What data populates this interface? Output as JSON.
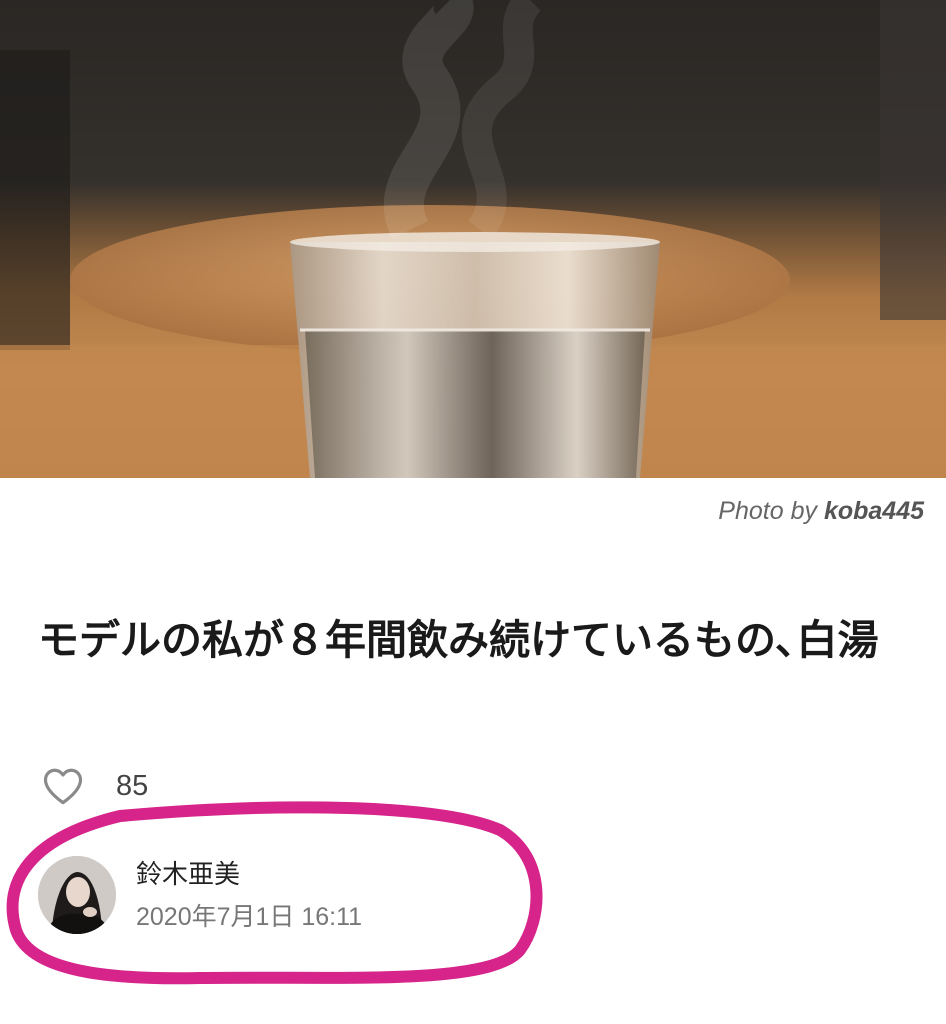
{
  "hero_image": {
    "caption_prefix": "Photo by",
    "caption_author": "koba445"
  },
  "article": {
    "title": "モデルの私が８年間飲み続けているもの､白湯",
    "like_count": "85"
  },
  "author": {
    "name": "鈴木亜美",
    "date": "2020年7月1日 16:11"
  },
  "colors": {
    "highlight": "#d6248a",
    "text": "#1a1a1a",
    "muted": "#777777"
  },
  "icons": {
    "like": "heart-outline-icon"
  }
}
